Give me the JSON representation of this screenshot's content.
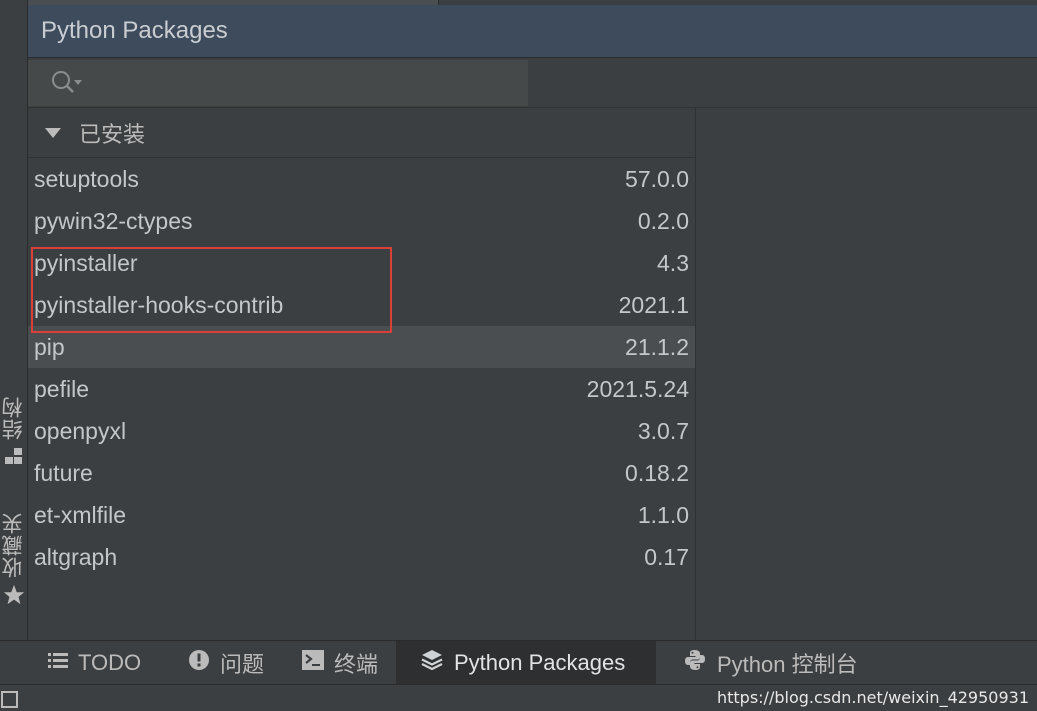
{
  "header": {
    "title": "Python Packages"
  },
  "search": {
    "value": "",
    "placeholder": ""
  },
  "group": {
    "label": "已安装"
  },
  "packages": [
    {
      "name": "setuptools",
      "version": "57.0.0"
    },
    {
      "name": "pywin32-ctypes",
      "version": "0.2.0"
    },
    {
      "name": "pyinstaller",
      "version": "4.3"
    },
    {
      "name": "pyinstaller-hooks-contrib",
      "version": "2021.1"
    },
    {
      "name": "pip",
      "version": "21.1.2"
    },
    {
      "name": "pefile",
      "version": "2021.5.24"
    },
    {
      "name": "openpyxl",
      "version": "3.0.7"
    },
    {
      "name": "future",
      "version": "0.18.2"
    },
    {
      "name": "et-xmlfile",
      "version": "1.1.0"
    },
    {
      "name": "altgraph",
      "version": "0.17"
    }
  ],
  "selected_package": "pip",
  "left_tabs": {
    "structure": "结构",
    "favorites": "收藏夹"
  },
  "bottom_tabs": {
    "todo": "TODO",
    "problems": "问题",
    "terminal": "终端",
    "python_packages": "Python Packages",
    "python_console": "Python 控制台"
  },
  "watermark": "https://blog.csdn.net/weixin_42950931",
  "colors": {
    "background": "#3c3f41",
    "header": "#3d4b5c",
    "selection": "#4b4e51",
    "highlight_border": "#d9403a"
  }
}
